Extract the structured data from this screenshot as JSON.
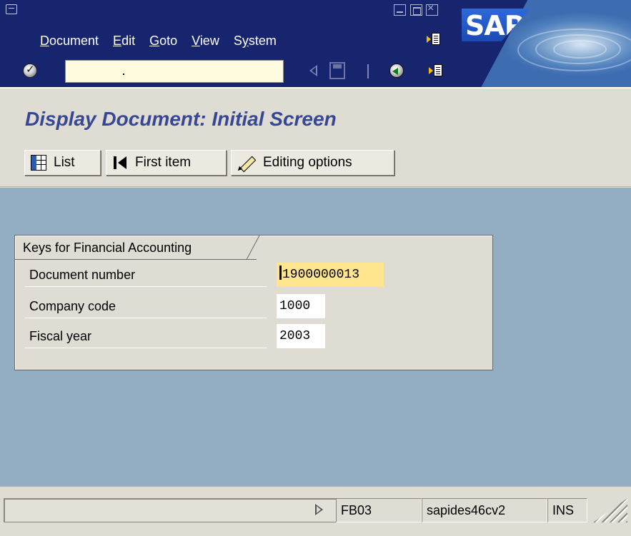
{
  "menubar": {
    "items": [
      {
        "label": "Document",
        "mnemonic": "D"
      },
      {
        "label": "Edit",
        "mnemonic": "E"
      },
      {
        "label": "Goto",
        "mnemonic": "G"
      },
      {
        "label": "View",
        "mnemonic": "V"
      },
      {
        "label": "System",
        "mnemonic": "y"
      }
    ],
    "logo_text": "SAP"
  },
  "toolbar": {
    "command_field_value": "",
    "icons": [
      "enter-icon",
      "dropdown-history-icon",
      "back-icon",
      "save-icon",
      "exit-icon",
      "generate-session-icon"
    ]
  },
  "titlebar": {
    "title": "Display Document: Initial Screen"
  },
  "apptoolbar": {
    "buttons": [
      {
        "label": "List",
        "icon": "list-icon"
      },
      {
        "label": "First item",
        "icon": "first-item-icon"
      },
      {
        "label": "Editing options",
        "icon": "pencil-icon"
      }
    ]
  },
  "form": {
    "group_title": "Keys for Financial Accounting",
    "fields": [
      {
        "label": "Document number",
        "value": "1900000013"
      },
      {
        "label": "Company code",
        "value": "1000"
      },
      {
        "label": "Fiscal year",
        "value": "2003"
      }
    ]
  },
  "statusbar": {
    "message": "",
    "transaction_code": "FB03",
    "server": "sapides46cv2",
    "mode": "INS"
  },
  "colors": {
    "menubar_bg": "#17246e",
    "title_text": "#364895",
    "workarea_bg": "#93aec2",
    "focused_field_bg": "#fee58e",
    "command_field_bg": "#fefbde"
  }
}
